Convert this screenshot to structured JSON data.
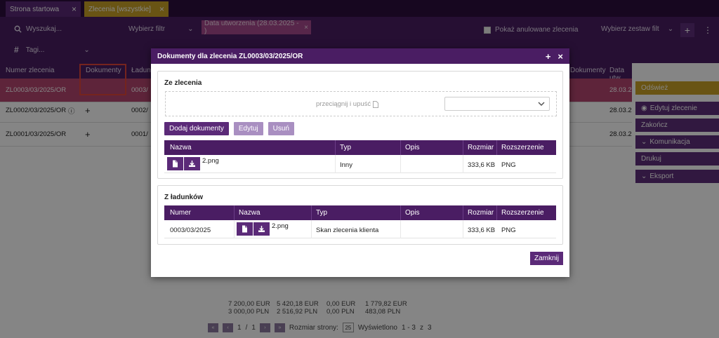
{
  "tabs": [
    {
      "label": "Strona startowa"
    },
    {
      "label": "Zlecenia [wszystkie]"
    }
  ],
  "toolbar": {
    "search_placeholder": "Wyszukaj...",
    "filter_select": "Wybierz filtr",
    "date_chip": "Data utworzenia (28.03.2025 - )",
    "show_cancelled": "Pokaż anulowane zlecenia",
    "filter_set": "Wybierz zestaw filt",
    "tags": "Tagi..."
  },
  "grid": {
    "headers": [
      "Numer zlecenia",
      "Dokumenty",
      "Ładun",
      "Dokumenty",
      "Data utw..."
    ],
    "rows": [
      {
        "number": "ZL0003/03/2025/OR",
        "load": "0003/",
        "date": "28.03.2"
      },
      {
        "number": "ZL0002/03/2025/OR",
        "load": "0002/",
        "date": "28.03.2"
      },
      {
        "number": "ZL0001/03/2025/OR",
        "load": "0001/",
        "date": "28.03.2"
      }
    ]
  },
  "side_actions": [
    "Odśwież",
    "Edytuj zlecenie",
    "Zakończ",
    "Komunikacja",
    "Drukuj",
    "Eksport"
  ],
  "footer": {
    "sum_col1": [
      "7 200,00 EUR",
      "3 000,00 PLN"
    ],
    "sum_col2": [
      "5 420,18 EUR",
      "2 516,92 PLN"
    ],
    "sum_col3": [
      "0,00 EUR",
      "0,00 PLN"
    ],
    "sum_col4": [
      "1 779,82 EUR",
      "483,08 PLN"
    ],
    "page_current": "1",
    "page_sep": "/",
    "page_total": "1",
    "page_size_label": "Rozmiar strony:",
    "page_size": "25",
    "shown_label": "Wyświetlono",
    "shown_range": "1 - 3",
    "shown_of": "z",
    "shown_total": "3"
  },
  "modal": {
    "title": "Dokumenty dla zlecenia ZL0003/03/2025/OR",
    "section1": {
      "title": "Ze zlecenia",
      "dropzone_text": "przeciągnij i upuść",
      "buttons": {
        "add": "Dodaj dokumenty",
        "edit": "Edytuj",
        "delete": "Usuń"
      },
      "headers": {
        "name": "Nazwa",
        "type": "Typ",
        "desc": "Opis",
        "size": "Rozmiar",
        "ext": "Rozszerzenie"
      },
      "rows": [
        {
          "name": "2.png",
          "type": "Inny",
          "desc": "",
          "size": "333,6 KB",
          "ext": "PNG"
        }
      ]
    },
    "section2": {
      "title": "Z ładunków",
      "headers": {
        "number": "Numer",
        "name": "Nazwa",
        "type": "Typ",
        "desc": "Opis",
        "size": "Rozmiar",
        "ext": "Rozszerzenie"
      },
      "rows": [
        {
          "number": "0003/03/2025",
          "name": "2.png",
          "type": "Skan zlecenia klienta",
          "desc": "",
          "size": "333,6 KB",
          "ext": "PNG"
        }
      ]
    },
    "close_label": "Zamknij"
  },
  "colors": {
    "brand": "#4a1d63",
    "accent": "#5b2a78",
    "gold": "#c9a227",
    "selected_row": "#b4456f"
  }
}
